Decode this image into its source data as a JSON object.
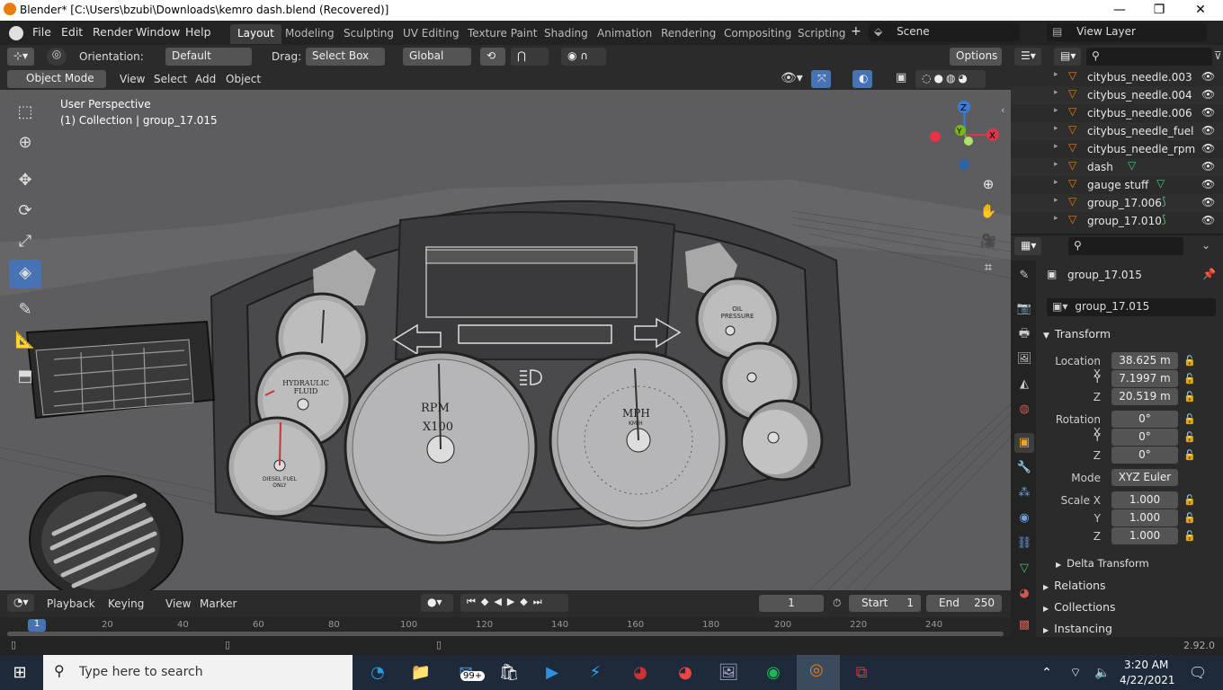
{
  "window": {
    "title": "Blender* [C:\\Users\\bzubi\\Downloads\\kemro dash.blend (Recovered)]"
  },
  "menu": {
    "file": "File",
    "edit": "Edit",
    "render": "Render",
    "window": "Window",
    "help": "Help"
  },
  "workspaces": [
    "Layout",
    "Modeling",
    "Sculpting",
    "UV Editing",
    "Texture Paint",
    "Shading",
    "Animation",
    "Rendering",
    "Compositing",
    "Scripting"
  ],
  "scene": {
    "name": "Scene",
    "view_layer": "View Layer"
  },
  "header1": {
    "orientation_label": "Orientation:",
    "orientation": "Default",
    "drag_label": "Drag:",
    "drag": "Select Box",
    "transform": "Global",
    "options": "Options"
  },
  "header2": {
    "mode": "Object Mode",
    "view": "View",
    "select": "Select",
    "add": "Add",
    "object": "Object"
  },
  "viewport": {
    "perspective": "User Perspective",
    "collection": "(1) Collection | group_17.015"
  },
  "gauges": {
    "rpm": "RPM",
    "rpm_unit": "X100",
    "mph": "MPH",
    "km": "KM/H",
    "oil": "OIL PRESSURE",
    "hyd": "HYDRAULIC FLUID",
    "fuel": "DIESEL FUEL ONLY"
  },
  "outliner": {
    "items": [
      "citybus_needle.003",
      "citybus_needle.004",
      "citybus_needle.006",
      "citybus_needle_fuel",
      "citybus_needle_rpm",
      "dash",
      "gauge stuff",
      "group_17.006",
      "group_17.010"
    ]
  },
  "properties": {
    "object_name": "group_17.015",
    "data_name": "group_17.015",
    "transform_label": "Transform",
    "location_label": "Location X",
    "location": [
      "38.625 m",
      "7.1997 m",
      "20.519 m"
    ],
    "rotation_label": "Rotation X",
    "rotation": [
      "0°",
      "0°",
      "0°"
    ],
    "mode_label": "Mode",
    "mode": "XYZ Euler",
    "scale_label": "Scale X",
    "scale": [
      "1.000",
      "1.000",
      "1.000"
    ],
    "y": "Y",
    "z": "Z",
    "delta": "Delta Transform",
    "relations": "Relations",
    "collections": "Collections",
    "instancing": "Instancing"
  },
  "timeline": {
    "playback": "Playback",
    "keying": "Keying",
    "view": "View",
    "marker": "Marker",
    "frame": "1",
    "start_label": "Start",
    "start": "1",
    "end_label": "End",
    "end": "250",
    "ticks": [
      "1",
      "20",
      "40",
      "60",
      "80",
      "100",
      "120",
      "140",
      "160",
      "180",
      "200",
      "220",
      "240"
    ]
  },
  "status": {
    "version": "2.92.0"
  },
  "taskbar": {
    "search": "Type here to search",
    "time": "3:20 AM",
    "date": "4/22/2021",
    "badge": "99+"
  }
}
